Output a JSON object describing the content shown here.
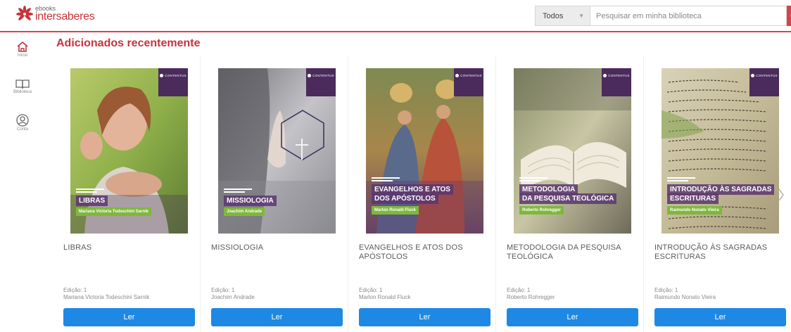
{
  "brand": {
    "small": "ebooks",
    "big": "intersaberes",
    "accent": "#c8323a"
  },
  "search": {
    "filter": "Todos",
    "placeholder": "Pesquisar em minha biblioteca",
    "button_color": "#d9424a"
  },
  "sidebar": {
    "items": [
      {
        "label": "Início",
        "icon": "home-icon"
      },
      {
        "label": "Biblioteca",
        "icon": "book-icon"
      },
      {
        "label": "Conta",
        "icon": "user-icon"
      }
    ]
  },
  "section": {
    "title": "Adicionados recentemente"
  },
  "cover_badge": "CONTENTUS",
  "books": [
    {
      "title": "LIBRAS",
      "cover_title": [
        "LIBRAS"
      ],
      "cover_author": "Mariana Victoria Todeschini Sarnik",
      "edition": "Edição: 1",
      "author": "Mariana Victoria Todeschini Sarnik",
      "button": "Ler"
    },
    {
      "title": "MISSIOLOGIA",
      "cover_title": [
        "MISSIOLOGIA"
      ],
      "cover_author": "Joachim Andrade",
      "edition": "Edição: 1",
      "author": "Joachim Andrade",
      "button": "Ler"
    },
    {
      "title": "EVANGELHOS E ATOS DOS APÓSTOLOS",
      "cover_title": [
        "EVANGELHOS E ATOS",
        "DOS APÓSTOLOS"
      ],
      "cover_author": "Marlon Ronald Fluck",
      "edition": "Edição: 1",
      "author": "Marlon Ronald Fluck",
      "button": "Ler"
    },
    {
      "title": "METODOLOGIA DA PESQUISA TEOLÓGICA",
      "cover_title": [
        "METODOLOGIA",
        "DA PESQUISA TEOLÓGICA"
      ],
      "cover_author": "Roberto Rohregger",
      "edition": "Edição: 1",
      "author": "Roberto Rohregger",
      "button": "Ler"
    },
    {
      "title": "INTRODUÇÃO ÀS SAGRADAS ESCRITURAS",
      "cover_title": [
        "INTRODUÇÃO ÀS SAGRADAS",
        "ESCRITURAS"
      ],
      "cover_author": "Raimundo Nonato Vieira",
      "edition": "Edição: 1",
      "author": "Raimundo Nonato Vieira",
      "button": "Ler"
    }
  ],
  "colors": {
    "read_button": "#1e88e5",
    "cover_title_bg": "#5c376e",
    "cover_author_bg": "#7fb83c",
    "badge_bg": "#4a2b5c"
  }
}
